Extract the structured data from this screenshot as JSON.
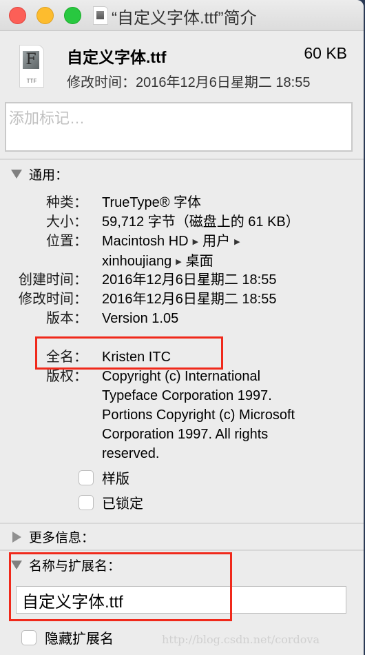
{
  "window": {
    "title": "“自定义字体.ttf”简介"
  },
  "header": {
    "file_icon_ext": "TTF",
    "file_icon_glyph": "F",
    "file_name": "自定义字体.ttf",
    "file_size": "60 KB",
    "modified": "修改时间：2016年12月6日星期二 18:55"
  },
  "tags": {
    "placeholder": "添加标记…",
    "value": ""
  },
  "general": {
    "header": "通用：",
    "expanded": true,
    "rows": [
      {
        "label": "种类：",
        "value": "TrueType® 字体"
      },
      {
        "label": "大小：",
        "value": "59,712 字节（磁盘上的 61 KB）"
      },
      {
        "label": "位置：",
        "path": [
          "Macintosh HD",
          "用户",
          "xinhoujiang",
          "桌面"
        ]
      },
      {
        "label": "创建时间：",
        "value": "2016年12月6日星期二 18:55"
      },
      {
        "label": "修改时间：",
        "value": "2016年12月6日星期二 18:55"
      },
      {
        "label": "版本：",
        "value": "Version 1.05"
      },
      {
        "label": "全名：",
        "value": "Kristen ITC"
      },
      {
        "label": "版权：",
        "value_lines": [
          "Copyright (c) International",
          "Typeface Corporation 1997.",
          "Portions Copyright (c) Microsoft",
          "Corporation 1997.  All rights",
          "reserved."
        ]
      }
    ],
    "checkboxes": [
      {
        "label": "样版",
        "checked": false
      },
      {
        "label": "已锁定",
        "checked": false
      }
    ]
  },
  "more_info": {
    "header": "更多信息：",
    "expanded": false
  },
  "name_ext": {
    "header": "名称与扩展名：",
    "expanded": true,
    "value": "自定义字体.ttf",
    "hide_ext_label": "隐藏扩展名",
    "hide_ext_checked": false
  },
  "annotation": {
    "highlight_color": "#f0291b"
  },
  "watermark": "http://blog.csdn.net/cordova"
}
